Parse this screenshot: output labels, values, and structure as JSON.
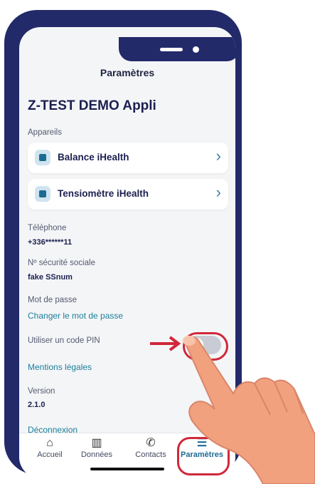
{
  "screen": {
    "title": "Paramètres",
    "app_name": "Z-TEST DEMO Appli",
    "devices_label": "Appareils",
    "devices": [
      {
        "label": "Balance iHealth",
        "icon": "scale-icon"
      },
      {
        "label": "Tensiomètre iHealth",
        "icon": "blood-pressure-icon"
      }
    ],
    "phone_label": "Téléphone",
    "phone_value": "+336******11",
    "ssn_label": "Nº sécurité sociale",
    "ssn_value": "fake SSnum",
    "password_label": "Mot de passe",
    "password_link": "Changer le mot de passe",
    "pin_label": "Utiliser un code PIN",
    "pin_enabled": false,
    "legal_link": "Mentions légales",
    "version_label": "Version",
    "version_value": "2.1.0",
    "logout_link": "Déconnexion"
  },
  "tabbar": {
    "items": [
      {
        "label": "Accueil",
        "icon": "home-icon",
        "active": false
      },
      {
        "label": "Données",
        "icon": "chart-icon",
        "active": false
      },
      {
        "label": "Contacts",
        "icon": "phone-icon",
        "active": false
      },
      {
        "label": "Paramètres",
        "icon": "sliders-icon",
        "active": true
      }
    ]
  },
  "colors": {
    "frame": "#222a6a",
    "accent": "#1b6c93",
    "highlight": "#d0283a",
    "hand": "#f2a17f"
  }
}
